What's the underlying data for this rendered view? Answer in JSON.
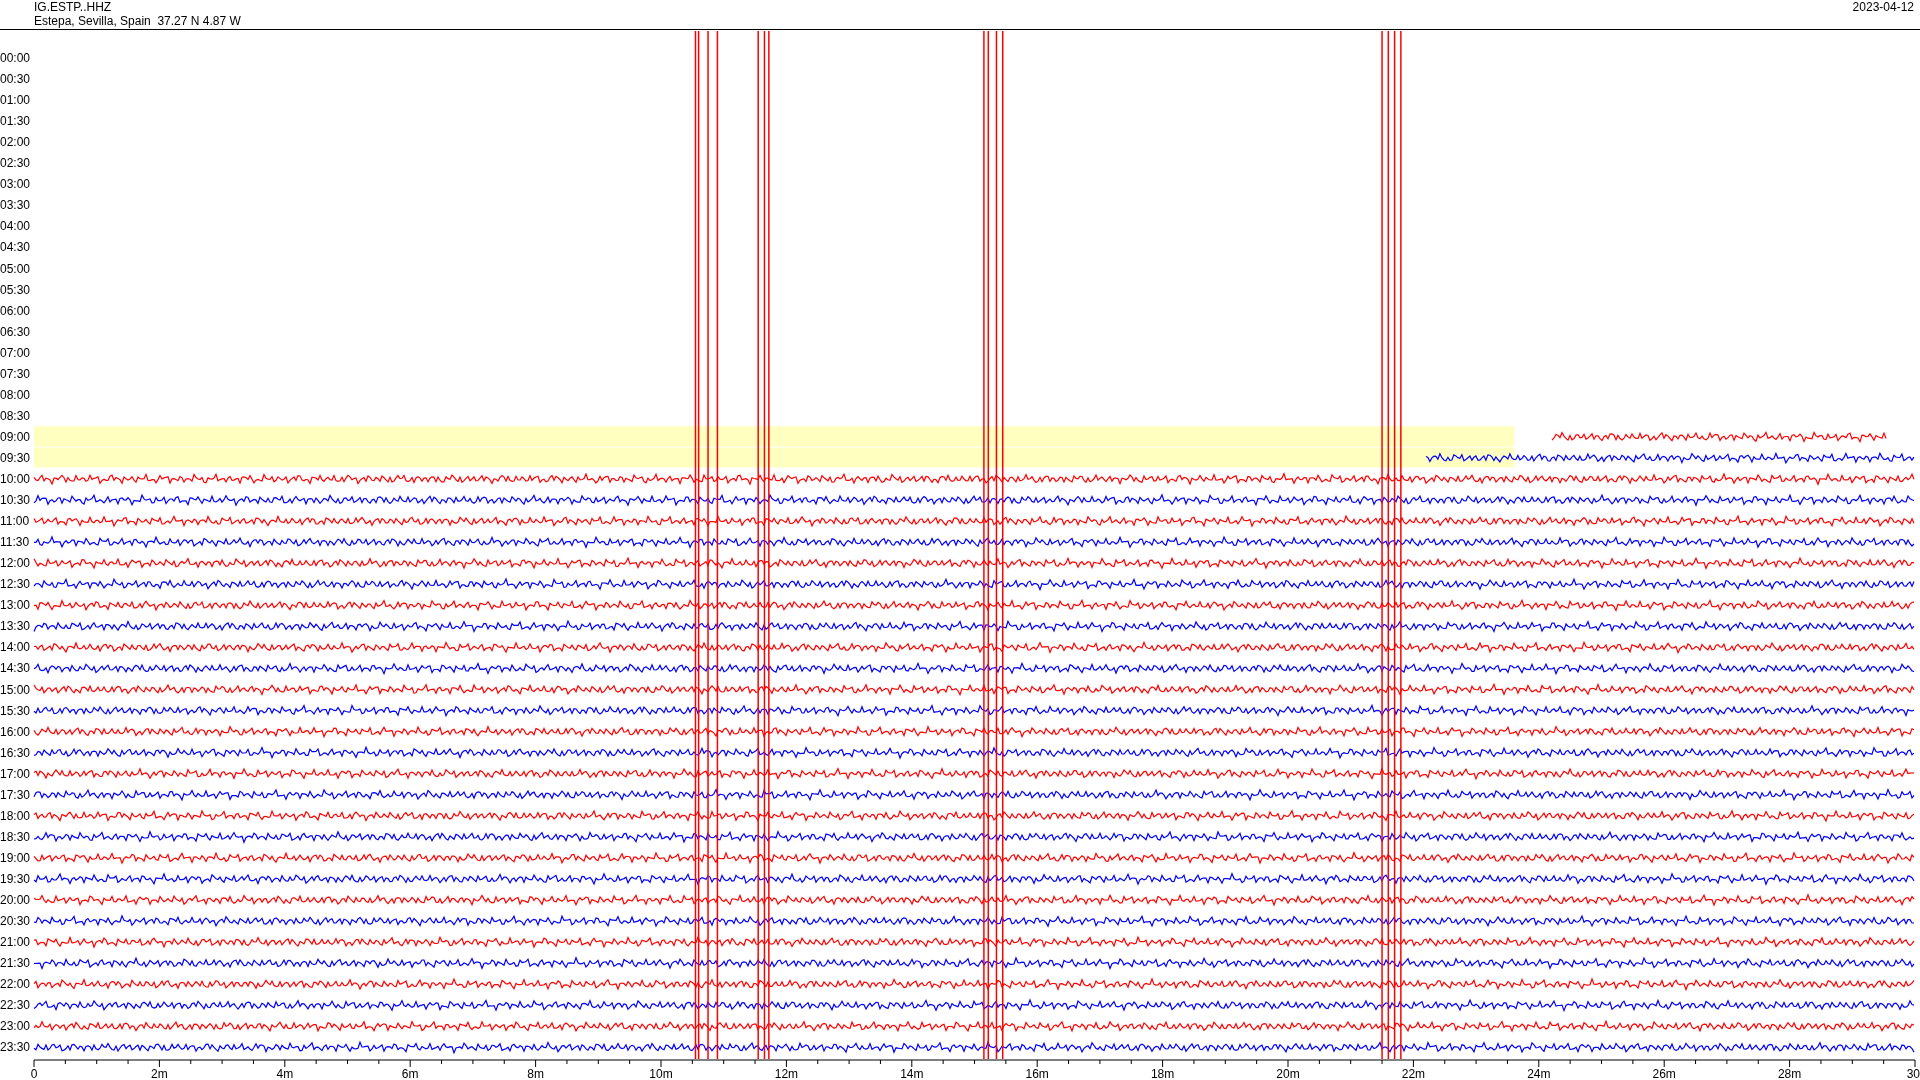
{
  "header": {
    "station": "IG.ESTP..HHZ",
    "location": "Estepa, Sevilla, Spain  37.27 N 4.87 W",
    "date": "2023-04-12"
  },
  "rows": [
    {
      "label": "00:00",
      "recorded": false,
      "highlighted": false
    },
    {
      "label": "00:30",
      "recorded": false,
      "highlighted": false
    },
    {
      "label": "01:00",
      "recorded": false,
      "highlighted": false
    },
    {
      "label": "01:30",
      "recorded": false,
      "highlighted": false
    },
    {
      "label": "02:00",
      "recorded": false,
      "highlighted": false
    },
    {
      "label": "02:30",
      "recorded": false,
      "highlighted": false
    },
    {
      "label": "03:00",
      "recorded": false,
      "highlighted": false
    },
    {
      "label": "03:30",
      "recorded": false,
      "highlighted": false
    },
    {
      "label": "04:00",
      "recorded": false,
      "highlighted": false
    },
    {
      "label": "04:30",
      "recorded": false,
      "highlighted": false
    },
    {
      "label": "05:00",
      "recorded": false,
      "highlighted": false
    },
    {
      "label": "05:30",
      "recorded": false,
      "highlighted": false
    },
    {
      "label": "06:00",
      "recorded": false,
      "highlighted": false
    },
    {
      "label": "06:30",
      "recorded": false,
      "highlighted": false
    },
    {
      "label": "07:00",
      "recorded": false,
      "highlighted": false
    },
    {
      "label": "07:30",
      "recorded": false,
      "highlighted": false
    },
    {
      "label": "08:00",
      "recorded": false,
      "highlighted": false
    },
    {
      "label": "08:30",
      "recorded": false,
      "highlighted": false
    },
    {
      "label": "09:00",
      "recorded": true,
      "partial": true,
      "color": "#ff0000",
      "highlighted": true
    },
    {
      "label": "09:30",
      "recorded": true,
      "partial": true,
      "color": "#0000ff",
      "highlighted": true
    },
    {
      "label": "10:00",
      "recorded": true,
      "partial": false,
      "color": "#ff0000",
      "highlighted": false
    },
    {
      "label": "10:30",
      "recorded": true,
      "partial": false,
      "color": "#0000ff",
      "highlighted": false
    },
    {
      "label": "11:00",
      "recorded": true,
      "partial": false,
      "color": "#ff0000",
      "highlighted": false
    },
    {
      "label": "11:30",
      "recorded": true,
      "partial": false,
      "color": "#0000ff",
      "highlighted": false
    },
    {
      "label": "12:00",
      "recorded": true,
      "partial": false,
      "color": "#ff0000",
      "highlighted": false
    },
    {
      "label": "12:30",
      "recorded": true,
      "partial": false,
      "color": "#0000ff",
      "highlighted": false
    },
    {
      "label": "13:00",
      "recorded": true,
      "partial": false,
      "color": "#ff0000",
      "highlighted": false
    },
    {
      "label": "13:30",
      "recorded": true,
      "partial": false,
      "color": "#0000ff",
      "highlighted": false
    },
    {
      "label": "14:00",
      "recorded": true,
      "partial": false,
      "color": "#ff0000",
      "highlighted": false
    },
    {
      "label": "14:30",
      "recorded": true,
      "partial": false,
      "color": "#0000ff",
      "highlighted": false
    },
    {
      "label": "15:00",
      "recorded": true,
      "partial": false,
      "color": "#ff0000",
      "highlighted": false
    },
    {
      "label": "15:30",
      "recorded": true,
      "partial": false,
      "color": "#0000ff",
      "highlighted": false
    },
    {
      "label": "16:00",
      "recorded": true,
      "partial": false,
      "color": "#ff0000",
      "highlighted": false
    },
    {
      "label": "16:30",
      "recorded": true,
      "partial": false,
      "color": "#0000ff",
      "highlighted": false
    },
    {
      "label": "17:00",
      "recorded": true,
      "partial": false,
      "color": "#ff0000",
      "highlighted": false
    },
    {
      "label": "17:30",
      "recorded": true,
      "partial": false,
      "color": "#0000ff",
      "highlighted": false
    },
    {
      "label": "18:00",
      "recorded": true,
      "partial": false,
      "color": "#ff0000",
      "highlighted": false
    },
    {
      "label": "18:30",
      "recorded": true,
      "partial": false,
      "color": "#0000ff",
      "highlighted": false
    },
    {
      "label": "19:00",
      "recorded": true,
      "partial": false,
      "color": "#ff0000",
      "highlighted": false
    },
    {
      "label": "19:30",
      "recorded": true,
      "partial": false,
      "color": "#0000ff",
      "highlighted": false
    },
    {
      "label": "20:00",
      "recorded": true,
      "partial": false,
      "color": "#ff0000",
      "highlighted": false
    },
    {
      "label": "20:30",
      "recorded": true,
      "partial": false,
      "color": "#0000ff",
      "highlighted": false
    },
    {
      "label": "21:00",
      "recorded": true,
      "partial": false,
      "color": "#ff0000",
      "highlighted": false
    },
    {
      "label": "21:30",
      "recorded": true,
      "partial": false,
      "color": "#0000ff",
      "highlighted": false
    },
    {
      "label": "22:00",
      "recorded": true,
      "partial": false,
      "color": "#ff0000",
      "highlighted": false
    },
    {
      "label": "22:30",
      "recorded": true,
      "partial": false,
      "color": "#0000ff",
      "highlighted": false
    },
    {
      "label": "23:00",
      "recorded": true,
      "partial": false,
      "color": "#ff0000",
      "highlighted": false
    },
    {
      "label": "23:30",
      "recorded": true,
      "partial": false,
      "color": "#0000ff",
      "highlighted": false
    }
  ],
  "x_axis": {
    "ticks": [
      "0",
      "2m",
      "4m",
      "6m",
      "8m",
      "10m",
      "12m",
      "14m",
      "16m",
      "18m",
      "20m",
      "22m",
      "24m",
      "26m",
      "28m",
      "30"
    ]
  }
}
